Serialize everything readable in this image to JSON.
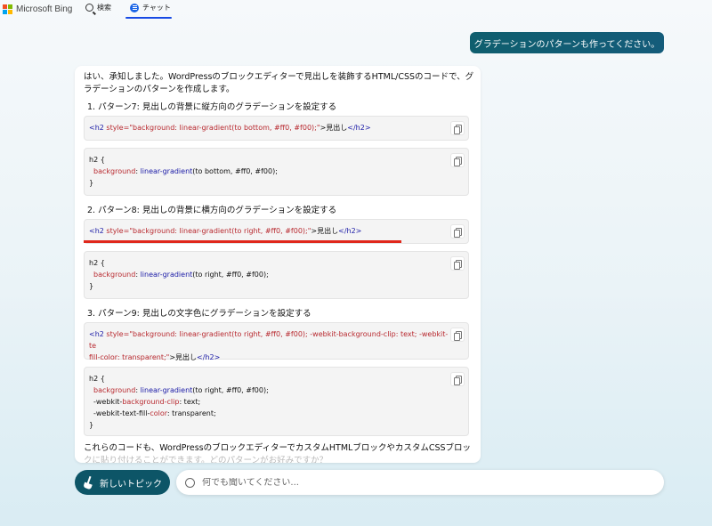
{
  "header": {
    "logo_text": "Microsoft Bing",
    "tabs": [
      {
        "label": "検索",
        "icon": "search-icon"
      },
      {
        "label": "チャット",
        "icon": "chat-icon",
        "active": true
      }
    ]
  },
  "user_message": "グラデーションのパターンも作ってください。",
  "bot": {
    "intro": "はい、承知しました。WordPressのブロックエディターで見出しを装飾するHTML/CSSのコードで、グラデーションのパターンを作成します。",
    "headings": [
      "1. パターン7: 見出しの背景に縦方向のグラデーションを設定する",
      "2. パターン8: 見出しの背景に横方向のグラデーションを設定する",
      "3. パターン9: 見出しの文字色にグラデーションを設定する"
    ],
    "code": {
      "p7_html": {
        "open_tag": "<h2",
        "attr": " style=",
        "val": "\"background: linear-gradient(to bottom, #ff0, #f00);\"",
        "close": ">",
        "text": "見出し",
        "end_tag": "</h2>"
      },
      "p7_css": [
        "h2 {",
        "background",
        ": ",
        "linear-gradient",
        "(to bottom, #ff0, #f00);",
        "}"
      ],
      "p8_html": {
        "open_tag": "<h2",
        "attr": " style=",
        "val": "\"background: linear-gradient(to right, #ff0, #f00);\"",
        "close": ">",
        "text": "見出し",
        "end_tag": "</h2>"
      },
      "p8_css": [
        "h2 {",
        "background",
        ": ",
        "linear-gradient",
        "(to right, #ff0, #f00);",
        "}"
      ],
      "p9_html_line1": "\"background: linear-gradient(to right, #ff0, #f00); -webkit-background-clip: text; -webkit-te",
      "p9_html_line2": "fill-color: transparent;\"",
      "p9_css": {
        "line1a": "h2 {",
        "bg_prop": "background",
        "bg_fn": "linear-gradient",
        "bg_args": "(to right, #ff0, #f00);",
        "clip_pre": "-webkit-",
        "clip_prop": "background-clip",
        "clip_val": ": text;",
        "fill_pre": "-webkit-text-fill-",
        "fill_prop": "color",
        "fill_val": ": transparent;",
        "close": "}"
      }
    },
    "closing_visible": "これらのコードも、WordPressのブロックエディターでカスタムHTMLブロックやカスタムCSSブロッ",
    "closing_faded": "クに貼り付けることができます。どのパターンがお好みですか？"
  },
  "bottom": {
    "new_topic_label": "新しいトピック",
    "input_placeholder": "何でも聞いてください..."
  },
  "colors": {
    "accent": "#0d5567",
    "tab_underline": "#174ae4",
    "annotation_line": "#e0281c"
  }
}
